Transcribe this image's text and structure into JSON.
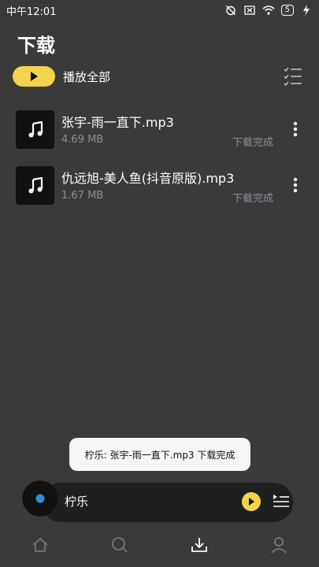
{
  "status_bar": {
    "time": "中午12:01",
    "battery": "5"
  },
  "header": {
    "title": "下载"
  },
  "play_all": {
    "label": "播放全部"
  },
  "downloads": [
    {
      "name": "张宇-雨一直下.mp3",
      "size": "4.69 MB",
      "status": "下载完成"
    },
    {
      "name": "仇远旭-美人鱼(抖音原版).mp3",
      "size": "1.67 MB",
      "status": "下载完成"
    }
  ],
  "toast": {
    "text": "柠乐: 张宇-雨一直下.mp3 下载完成"
  },
  "player": {
    "title": "柠乐"
  },
  "colors": {
    "accent": "#f3d34d",
    "background": "#3a3a3a",
    "muted_text": "#8a8f9a"
  },
  "icons": {
    "play": "play-icon",
    "multi_select": "checklist-icon",
    "music": "music-note-icon",
    "more": "more-vertical-icon",
    "queue": "playlist-icon",
    "nav": [
      "home-icon",
      "search-icon",
      "download-icon",
      "profile-icon"
    ]
  }
}
